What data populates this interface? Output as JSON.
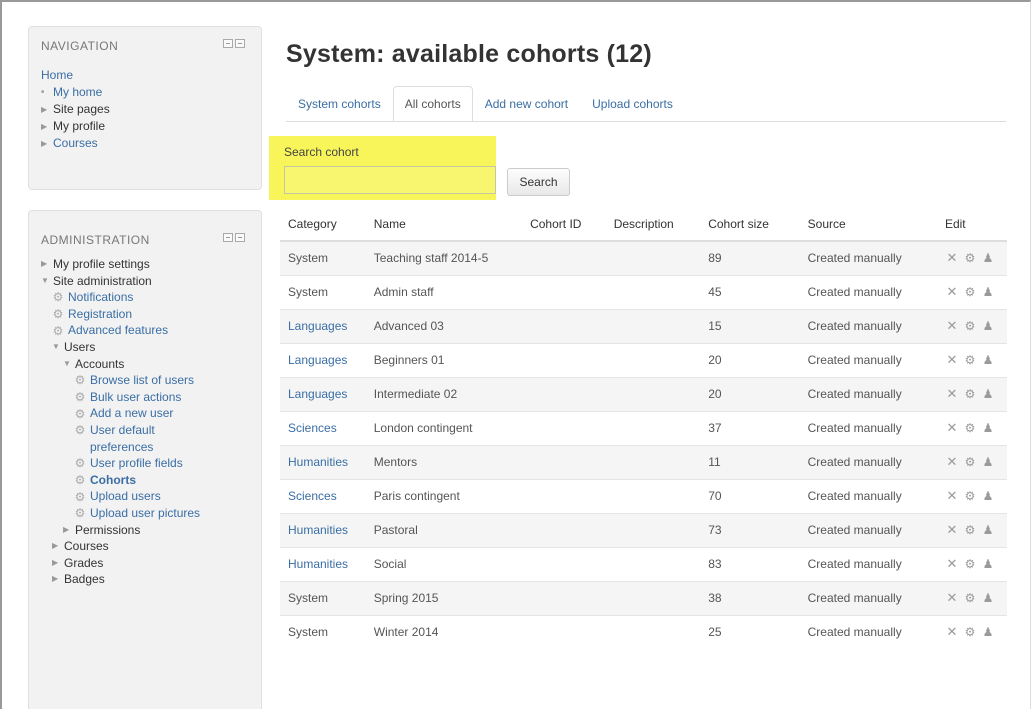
{
  "navigation": {
    "title": "NAVIGATION",
    "items": [
      {
        "label": "Home",
        "marker": ""
      },
      {
        "label": "My home",
        "marker": "■"
      },
      {
        "label": "Site pages",
        "marker": "▶"
      },
      {
        "label": "My profile",
        "marker": "▶"
      },
      {
        "label": "Courses",
        "marker": "▶"
      }
    ]
  },
  "administration": {
    "title": "ADMINISTRATION",
    "items": [
      {
        "label": "My profile settings",
        "marker": "▶",
        "indent": 0,
        "type": "text"
      },
      {
        "label": "Site administration",
        "marker": "▼",
        "indent": 0,
        "type": "text"
      },
      {
        "label": "Notifications",
        "indent": 1,
        "type": "gear-link"
      },
      {
        "label": "Registration",
        "indent": 1,
        "type": "gear-link"
      },
      {
        "label": "Advanced features",
        "indent": 1,
        "type": "gear-link"
      },
      {
        "label": "Users",
        "marker": "▼",
        "indent": 1,
        "type": "text"
      },
      {
        "label": "Accounts",
        "marker": "▼",
        "indent": 2,
        "type": "text"
      },
      {
        "label": "Browse list of users",
        "indent": 3,
        "type": "gear-link"
      },
      {
        "label": "Bulk user actions",
        "indent": 3,
        "type": "gear-link"
      },
      {
        "label": "Add a new user",
        "indent": 3,
        "type": "gear-link"
      },
      {
        "label": "User default",
        "indent": 3,
        "type": "gear-link"
      },
      {
        "label": "preferences",
        "indent": 4,
        "type": "link"
      },
      {
        "label": "User profile fields",
        "indent": 3,
        "type": "gear-link"
      },
      {
        "label": "Cohorts",
        "indent": 3,
        "type": "gear-active"
      },
      {
        "label": "Upload users",
        "indent": 3,
        "type": "gear-link"
      },
      {
        "label": "Upload user pictures",
        "indent": 3,
        "type": "gear-link"
      },
      {
        "label": "Permissions",
        "marker": "▶",
        "indent": 2,
        "type": "text"
      },
      {
        "label": "Courses",
        "marker": "▶",
        "indent": 1,
        "type": "text"
      },
      {
        "label": "Grades",
        "marker": "▶",
        "indent": 1,
        "type": "text"
      },
      {
        "label": "Badges",
        "marker": "▶",
        "indent": 1,
        "type": "text"
      }
    ]
  },
  "page": {
    "title": "System: available cohorts (12)"
  },
  "tabs": [
    {
      "label": "System cohorts",
      "active": false
    },
    {
      "label": "All cohorts",
      "active": true
    },
    {
      "label": "Add new cohort",
      "active": false
    },
    {
      "label": "Upload cohorts",
      "active": false
    }
  ],
  "search": {
    "label": "Search cohort",
    "value": "",
    "button_label": "Search"
  },
  "table": {
    "headers": [
      "Category",
      "Name",
      "Cohort ID",
      "Description",
      "Cohort size",
      "Source",
      "Edit"
    ],
    "rows": [
      {
        "category": "System",
        "category_link": false,
        "name": "Teaching staff 2014-5",
        "cohort_id": "",
        "description": "",
        "size": "89",
        "source": "Created manually"
      },
      {
        "category": "System",
        "category_link": false,
        "name": "Admin staff",
        "cohort_id": "",
        "description": "",
        "size": "45",
        "source": "Created manually"
      },
      {
        "category": "Languages",
        "category_link": true,
        "name": "Advanced 03",
        "cohort_id": "",
        "description": "",
        "size": "15",
        "source": "Created manually"
      },
      {
        "category": "Languages",
        "category_link": true,
        "name": "Beginners 01",
        "cohort_id": "",
        "description": "",
        "size": "20",
        "source": "Created manually"
      },
      {
        "category": "Languages",
        "category_link": true,
        "name": "Intermediate 02",
        "cohort_id": "",
        "description": "",
        "size": "20",
        "source": "Created manually"
      },
      {
        "category": "Sciences",
        "category_link": true,
        "name": "London contingent",
        "cohort_id": "",
        "description": "",
        "size": "37",
        "source": "Created manually"
      },
      {
        "category": "Humanities",
        "category_link": true,
        "name": "Mentors",
        "cohort_id": "",
        "description": "",
        "size": "11",
        "source": "Created manually"
      },
      {
        "category": "Sciences",
        "category_link": true,
        "name": "Paris contingent",
        "cohort_id": "",
        "description": "",
        "size": "70",
        "source": "Created manually"
      },
      {
        "category": "Humanities",
        "category_link": true,
        "name": "Pastoral",
        "cohort_id": "",
        "description": "",
        "size": "73",
        "source": "Created manually"
      },
      {
        "category": "Humanities",
        "category_link": true,
        "name": "Social",
        "cohort_id": "",
        "description": "",
        "size": "83",
        "source": "Created manually"
      },
      {
        "category": "System",
        "category_link": false,
        "name": "Spring 2015",
        "cohort_id": "",
        "description": "",
        "size": "38",
        "source": "Created manually"
      },
      {
        "category": "System",
        "category_link": false,
        "name": "Winter 2014",
        "cohort_id": "",
        "description": "",
        "size": "25",
        "source": "Created manually"
      }
    ]
  },
  "icons": {
    "delete": "delete-icon",
    "edit": "gear-icon",
    "assign": "assign-users-icon",
    "tree_gear": "gear-icon"
  },
  "colors": {
    "link": "#3a6ea5",
    "highlight": "#f7f55a",
    "block_bg": "#f2f2f2"
  }
}
